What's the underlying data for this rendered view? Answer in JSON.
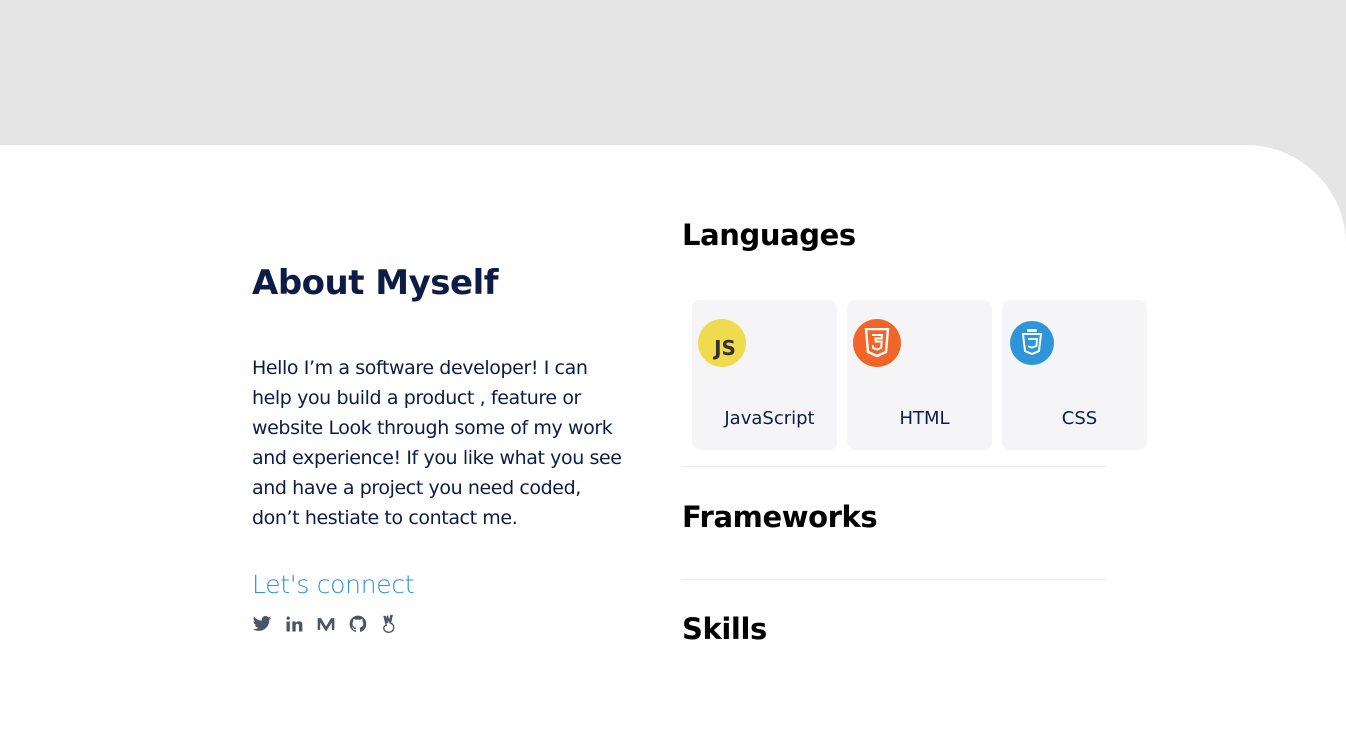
{
  "about": {
    "title": "About Myself",
    "body": "Hello I’m a software developer! I can help you build a product , feature or website Look through some of my work and experience! If you like what you see and have a project you need coded, don’t hestiate to contact me.",
    "connect_label": "Let's connect",
    "socials": [
      "twitter-icon",
      "linkedin-icon",
      "medium-icon",
      "github-icon",
      "angellist-icon"
    ]
  },
  "sections": {
    "languages": "Languages",
    "frameworks": "Frameworks",
    "skills": "Skills"
  },
  "languages": [
    {
      "name": "JavaScript",
      "logo": "JS",
      "color": "#f0db4f"
    },
    {
      "name": "HTML",
      "logo": "5",
      "color": "#f16529"
    },
    {
      "name": "CSS",
      "logo": "3",
      "color": "#2e95d8"
    }
  ],
  "colors": {
    "navy": "#0c1c47",
    "link": "#2f8fe6",
    "background": "#e5e5e5"
  }
}
